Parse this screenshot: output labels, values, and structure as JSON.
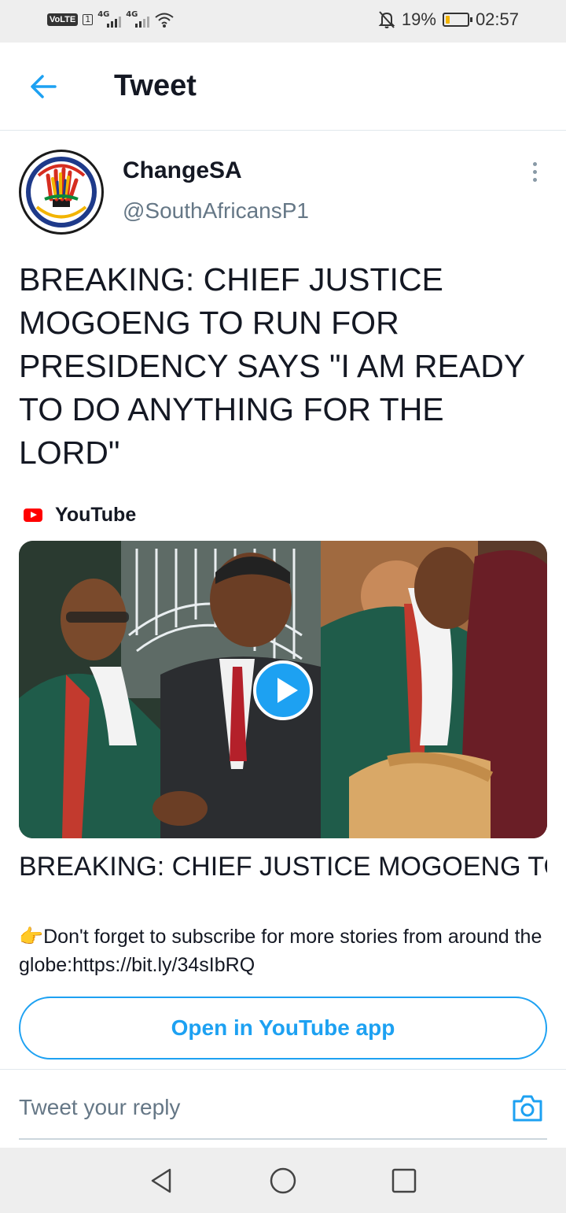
{
  "status_bar": {
    "volte": "VoLTE",
    "sim": "1",
    "network1": "4G",
    "network2": "4G",
    "battery_percent": "19%",
    "battery_level": 0.19,
    "time": "02:57"
  },
  "header": {
    "title": "Tweet"
  },
  "author": {
    "name": "ChangeSA",
    "handle": "@SouthAfricansP1"
  },
  "tweet": {
    "text": "BREAKING: CHIEF JUSTICE MOGOENG TO RUN FOR PRESIDENCY SAYS \"I AM READY TO DO ANYTHING FOR THE LORD\""
  },
  "card": {
    "source": "YouTube",
    "title": "BREAKING: CHIEF JUSTICE MOGOENG TO RUN FOR PRESIDENCY SAYS \"I AM...",
    "description": "👉Don't forget to subscribe for more stories from around the globe:https://bit.ly/34sIbRQ",
    "open_button": "Open in YouTube app"
  },
  "reply": {
    "placeholder": "Tweet your reply"
  },
  "colors": {
    "accent": "#1da1f2",
    "youtube_red": "#ff0000",
    "secondary_text": "#657786"
  },
  "icons": {
    "back": "arrow-left-icon",
    "more": "more-vertical-icon",
    "play": "play-icon",
    "camera": "camera-icon",
    "nav_back": "triangle-back-icon",
    "nav_home": "circle-home-icon",
    "nav_recents": "square-recents-icon"
  }
}
